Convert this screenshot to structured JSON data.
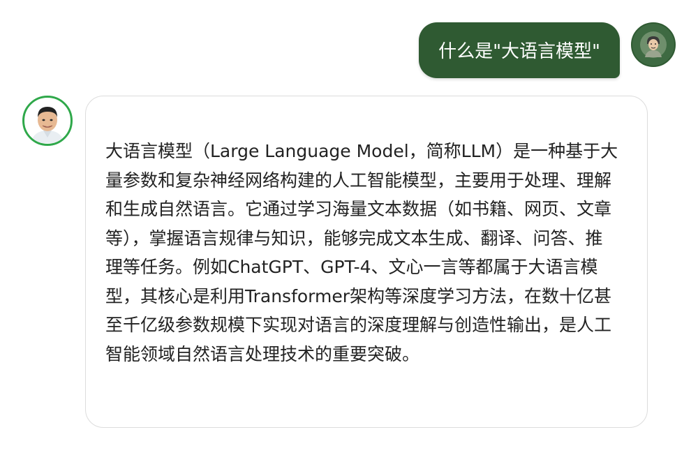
{
  "user_message": {
    "text": "什么是\"大语言模型\""
  },
  "assistant_message": {
    "text": "大语言模型（Large Language Model，简称LLM）是一种基于大量参数和复杂神经网络构建的人工智能模型，主要用于处理、理解和生成自然语言。它通过学习海量文本数据（如书籍、网页、文章等），掌握语言规律与知识，能够完成文本生成、翻译、问答、推理等任务。例如ChatGPT、GPT-4、文心一言等都属于大语言模型，其核心是利用Transformer架构等深度学习方法，在数十亿甚至千亿级参数规模下实现对语言的深度理解与创造性输出，是人工智能领域自然语言处理技术的重要突破。"
  },
  "colors": {
    "user_bubble": "#2f5a32",
    "bot_avatar_ring": "#2fa84a",
    "bubble_border": "#dcdcdc"
  },
  "icons": {
    "user_avatar": "person-avatar-icon",
    "bot_avatar": "assistant-avatar-icon"
  }
}
